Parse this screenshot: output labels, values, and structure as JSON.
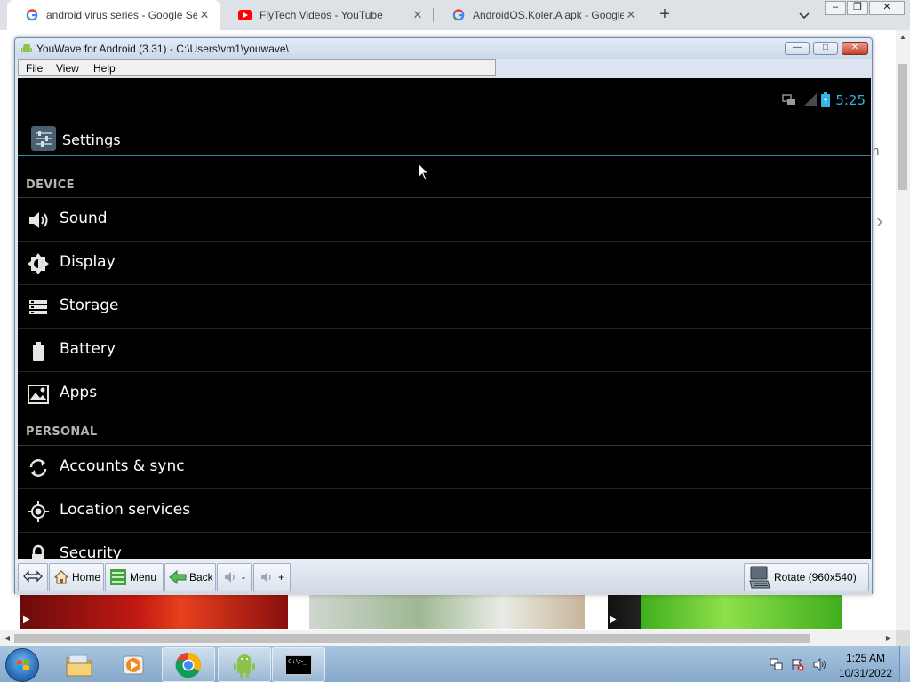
{
  "browser": {
    "tabs": [
      {
        "title": "android virus series - Google Sea",
        "favicon": "google-g-icon",
        "active": true
      },
      {
        "title": "FlyTech Videos - YouTube",
        "favicon": "youtube-icon",
        "active": false
      },
      {
        "title": "AndroidOS.Koler.A apk - Google",
        "favicon": "google-g-icon",
        "active": false
      }
    ],
    "new_tab": "+",
    "window_buttons": {
      "minimize": "–",
      "restore": "❐",
      "close": "✕"
    }
  },
  "background_page": {
    "right_fragment": "n"
  },
  "youwave": {
    "title": "YouWave for Android (3.31) - C:\\Users\\vm1\\youwave\\",
    "menu": {
      "file": "File",
      "view": "View",
      "help": "Help"
    },
    "window_buttons": {
      "minimize": "—",
      "restore": "□",
      "close": "✕"
    },
    "android": {
      "status_time": "5:25",
      "action_bar_title": "Settings",
      "sections": {
        "device": "DEVICE",
        "personal": "PERSONAL"
      },
      "device_items": [
        {
          "label": "Sound",
          "icon": "speaker-icon"
        },
        {
          "label": "Display",
          "icon": "brightness-icon"
        },
        {
          "label": "Storage",
          "icon": "storage-icon"
        },
        {
          "label": "Battery",
          "icon": "battery-icon"
        },
        {
          "label": "Apps",
          "icon": "apps-icon"
        }
      ],
      "personal_items": [
        {
          "label": "Accounts & sync",
          "icon": "sync-icon"
        },
        {
          "label": "Location services",
          "icon": "location-icon"
        },
        {
          "label": "Security",
          "icon": "lock-icon"
        }
      ]
    },
    "toolbar": {
      "home": "Home",
      "menu": "Menu",
      "back": "Back",
      "vol_down": "-",
      "vol_up": "+",
      "rotate": "Rotate (960x540)"
    }
  },
  "taskbar": {
    "apps": [
      "explorer-icon",
      "media-player-icon",
      "chrome-icon",
      "youwave-icon",
      "cmd-icon"
    ],
    "cmd_label": "C:\\>_",
    "time": "1:25 AM",
    "date": "10/31/2022"
  },
  "colors": {
    "android_accent": "#33b5e5",
    "android_bg": "#000000",
    "taskbar": "#93b3d5",
    "youtube_red": "#ff0000"
  }
}
